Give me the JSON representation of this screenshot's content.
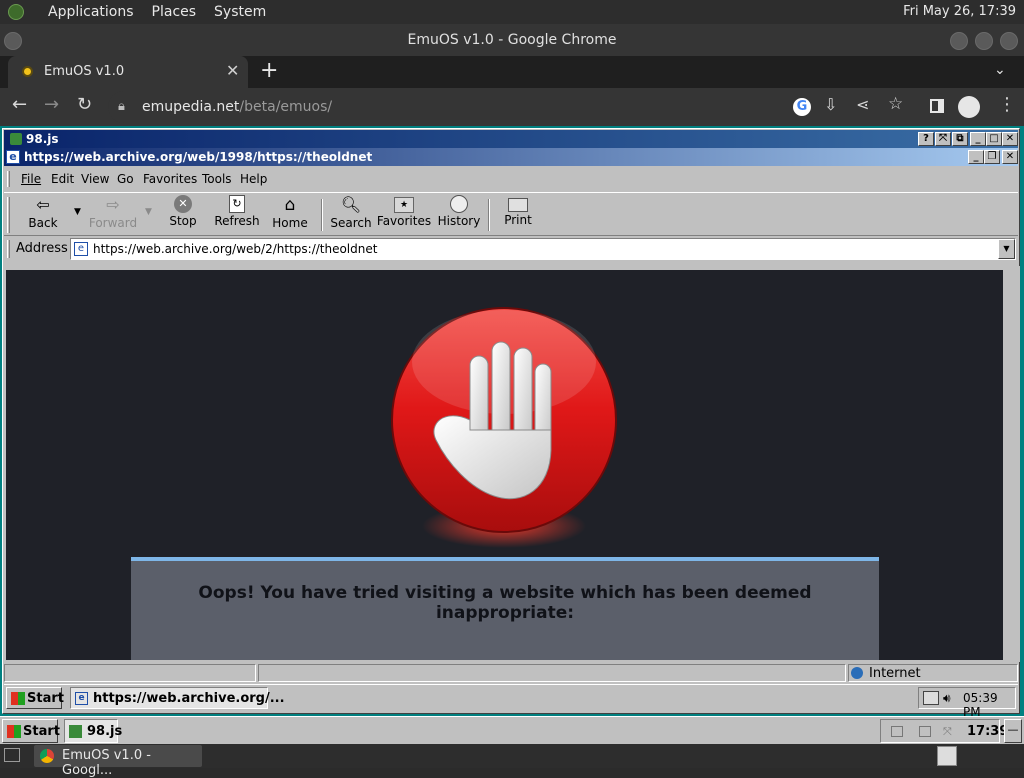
{
  "gnome": {
    "menus": [
      "Applications",
      "Places",
      "System"
    ],
    "clock": "Fri May 26, 17:39",
    "taskbar_item": "EmuOS v1.0 - Googl..."
  },
  "chrome": {
    "window_title": "EmuOS v1.0 - Google Chrome",
    "tab_title": "EmuOS v1.0",
    "url_host": "emupedia.net",
    "url_path": "/beta/emuos/"
  },
  "w98": {
    "app_window_title": "98.js",
    "ie_window_title": "https://web.archive.org/web/1998/https://theoldnet",
    "menu": [
      "File",
      "Edit",
      "View",
      "Go",
      "Favorites",
      "Tools",
      "Help"
    ],
    "toolbar": {
      "back": "Back",
      "forward": "Forward",
      "stop": "Stop",
      "refresh": "Refresh",
      "home": "Home",
      "search": "Search",
      "favorites": "Favorites",
      "history": "History",
      "print": "Print"
    },
    "address_label": "Address",
    "address_value": "https://web.archive.org/web/2/https://theoldnet",
    "page_message": "Oops! You have tried visiting a website which has been deemed inappropriate:",
    "status_zone": "Internet",
    "inner_taskbar": {
      "start": "Start",
      "task": "https://web.archive.org/...",
      "time": "05:39 PM"
    },
    "outer_taskbar": {
      "start": "Start",
      "task": "98.js",
      "time": "17:39"
    }
  },
  "colors": {
    "stop_red": "#d9141b",
    "ie_titlebar": "#0a246a",
    "panel_top": "#7eb6e8"
  }
}
